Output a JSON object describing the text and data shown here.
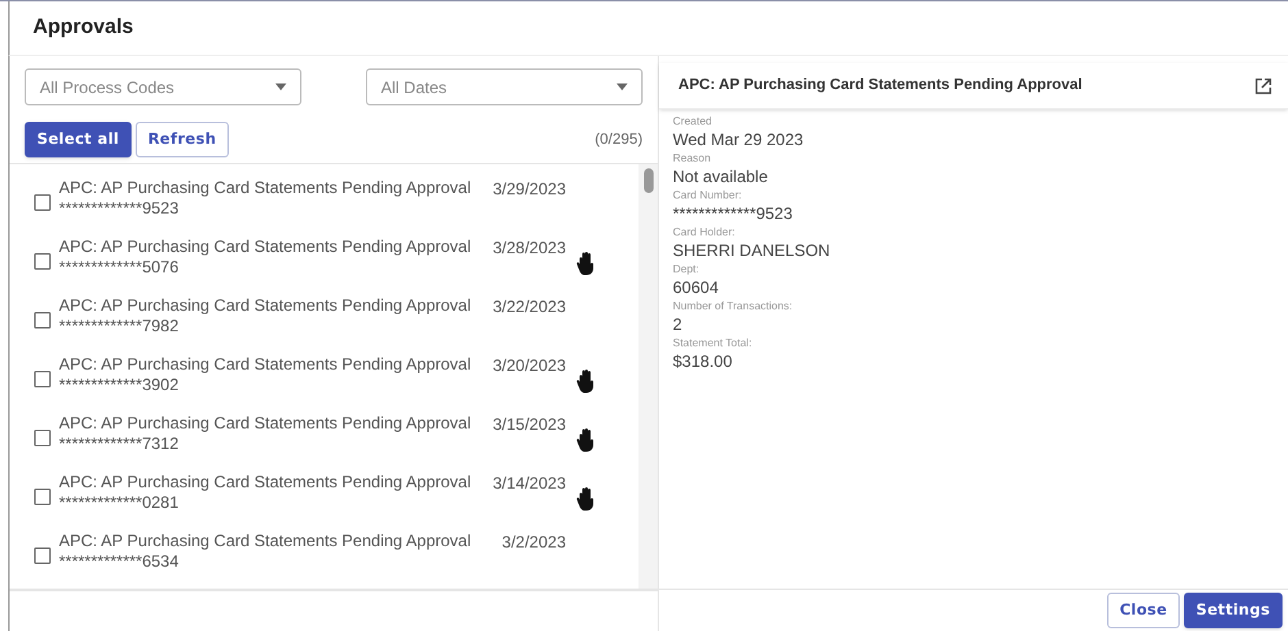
{
  "window": {
    "title": "Approvals"
  },
  "filters": [
    {
      "placeholder": "All Process Codes"
    },
    {
      "placeholder": "All Dates"
    }
  ],
  "actions": [
    {
      "label": "Select all",
      "kind": "primary"
    },
    {
      "label": "Refresh",
      "kind": "secondary"
    }
  ],
  "count": "(0/295)",
  "items": [
    {
      "title": "APC: AP Purchasing Card Statements Pending Approval",
      "card": "*************9523",
      "date": "3/29/2023",
      "checked": false,
      "on_hold": false
    },
    {
      "title": "APC: AP Purchasing Card Statements Pending Approval",
      "card": "*************5076",
      "date": "3/28/2023",
      "checked": false,
      "on_hold": true
    },
    {
      "title": "APC: AP Purchasing Card Statements Pending Approval",
      "card": "*************7982",
      "date": "3/22/2023",
      "checked": false,
      "on_hold": false
    },
    {
      "title": "APC: AP Purchasing Card Statements Pending Approval",
      "card": "*************3902",
      "date": "3/20/2023",
      "checked": false,
      "on_hold": true
    },
    {
      "title": "APC: AP Purchasing Card Statements Pending Approval",
      "card": "*************7312",
      "date": "3/15/2023",
      "checked": false,
      "on_hold": true
    },
    {
      "title": "APC: AP Purchasing Card Statements Pending Approval",
      "card": "*************0281",
      "date": "3/14/2023",
      "checked": false,
      "on_hold": true
    },
    {
      "title": "APC: AP Purchasing Card Statements Pending Approval",
      "card": "*************6534",
      "date": "3/2/2023",
      "checked": false,
      "on_hold": false
    }
  ],
  "detail": {
    "title": "APC: AP Purchasing Card Statements Pending Approval",
    "fields": [
      {
        "label": "Created",
        "value": "Wed Mar 29 2023"
      },
      {
        "label": "Reason",
        "value": "Not available"
      },
      {
        "label": "Card Number:",
        "value": "*************9523"
      },
      {
        "label": "Card Holder:",
        "value": "SHERRI DANELSON"
      },
      {
        "label": "Dept:",
        "value": "60604"
      },
      {
        "label": "Number of Transactions:",
        "value": "2"
      },
      {
        "label": "Statement Total:",
        "value": "$318.00"
      }
    ]
  },
  "footer": [
    {
      "label": "Close",
      "kind": "secondary"
    },
    {
      "label": "Settings",
      "kind": "primary"
    }
  ]
}
